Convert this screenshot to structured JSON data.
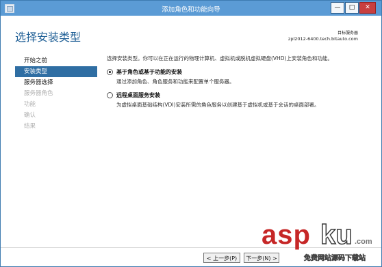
{
  "window": {
    "title": "添加角色和功能向导",
    "controls": {
      "minimize": "—",
      "maximize": "□",
      "close": "✕"
    }
  },
  "header": {
    "page_title": "选择安装类型",
    "server_label": "目标服务器",
    "server_name": "zpl2012-6400.tech.bitauto.com"
  },
  "nav": {
    "items": [
      {
        "label": "开始之前",
        "state": "normal"
      },
      {
        "label": "安装类型",
        "state": "active"
      },
      {
        "label": "服务器选择",
        "state": "normal"
      },
      {
        "label": "服务器角色",
        "state": "disabled"
      },
      {
        "label": "功能",
        "state": "disabled"
      },
      {
        "label": "确认",
        "state": "disabled"
      },
      {
        "label": "结果",
        "state": "disabled"
      }
    ]
  },
  "content": {
    "description": "选择安装类型。你可以在正在运行的物理计算机、虚拟机或脱机虚拟硬盘(VHD)上安装角色和功能。",
    "options": [
      {
        "title": "基于角色或基于功能的安装",
        "description": "通过添加角色、角色服务和功能来配置单个服务器。",
        "checked": true
      },
      {
        "title": "远程桌面服务安装",
        "description": "为虚拟桌面基础结构(VDI)安装所需的角色服务以创建基于虚拟机或基于会话的桌面部署。",
        "checked": false
      }
    ]
  },
  "footer": {
    "prev_label": "< 上一步(P)",
    "next_label": "下一步(N) >"
  },
  "watermark": {
    "brand_asp": "asp",
    "brand_ku": "ku",
    "brand_com": ".com",
    "subtitle": "免费网站源码下载站"
  }
}
